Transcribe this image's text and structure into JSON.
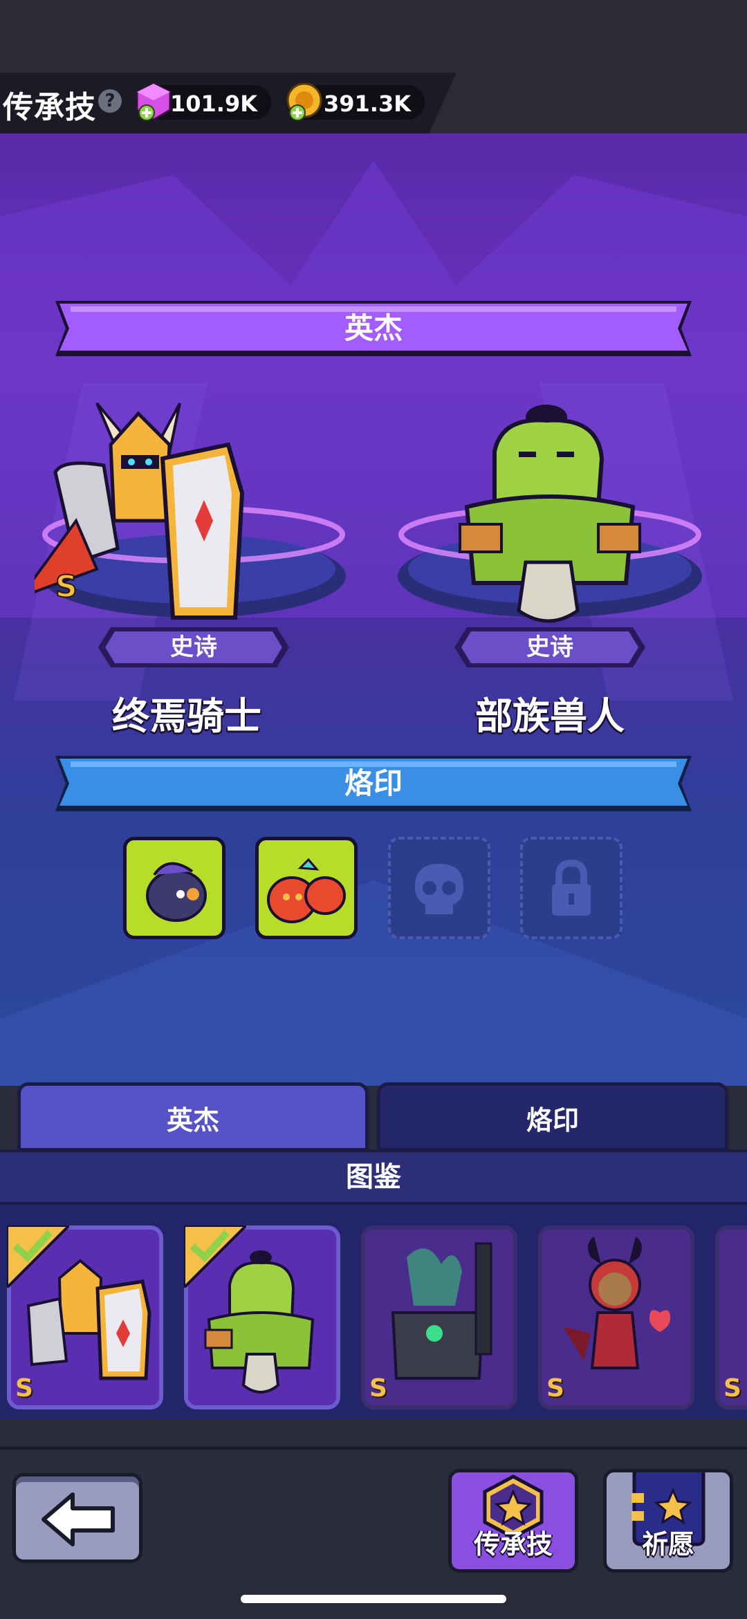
{
  "header": {
    "title": "传承技",
    "help_icon": "?",
    "gems": "101.9K",
    "coins": "391.3K"
  },
  "stage": {
    "heroes_ribbon": "英杰",
    "heroes": [
      {
        "name": "终焉骑士",
        "rarity": "史诗",
        "grade": "S"
      },
      {
        "name": "部族兽人",
        "rarity": "史诗"
      }
    ],
    "brand_ribbon": "烙印",
    "brand_slots": [
      "fish-monster",
      "twin-slime",
      "skull-empty",
      "locked"
    ]
  },
  "tabs": [
    {
      "label": "英杰",
      "active": true
    },
    {
      "label": "烙印",
      "active": false
    }
  ],
  "catalog": {
    "title": "图鉴",
    "cards": [
      {
        "hero": "knight",
        "grade": "S",
        "selected": true
      },
      {
        "hero": "orc",
        "grade": "",
        "selected": true
      },
      {
        "hero": "dark-knight",
        "grade": "S",
        "selected": false
      },
      {
        "hero": "demon-girl",
        "grade": "S",
        "selected": false
      },
      {
        "hero": "partial",
        "grade": "S",
        "selected": false
      }
    ]
  },
  "bottom_nav": {
    "legacy_label": "传承技",
    "wish_label": "祈愿"
  },
  "colors": {
    "ribbon_purple": "#a35cff",
    "ribbon_blue": "#3a8ee6",
    "slot_green": "#b7dc2a",
    "grade_gold": "#f4c04a"
  }
}
